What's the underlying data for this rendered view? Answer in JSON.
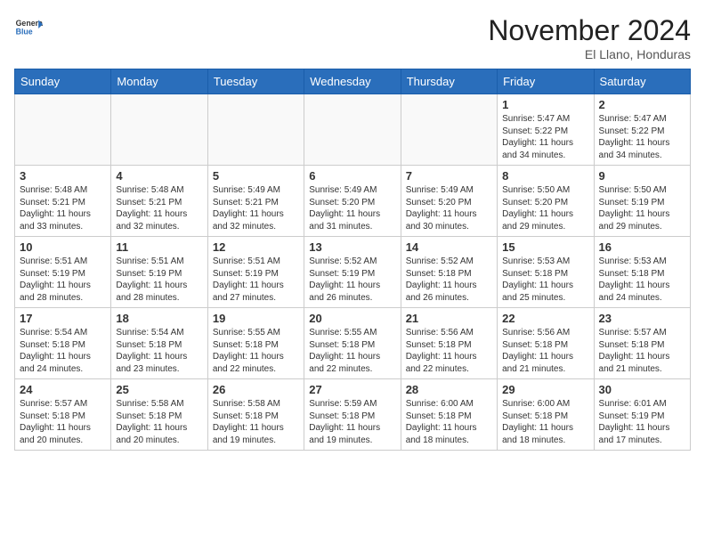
{
  "header": {
    "logo_general": "General",
    "logo_blue": "Blue",
    "month_year": "November 2024",
    "location": "El Llano, Honduras"
  },
  "days_of_week": [
    "Sunday",
    "Monday",
    "Tuesday",
    "Wednesday",
    "Thursday",
    "Friday",
    "Saturday"
  ],
  "weeks": [
    [
      {
        "day": "",
        "empty": true
      },
      {
        "day": "",
        "empty": true
      },
      {
        "day": "",
        "empty": true
      },
      {
        "day": "",
        "empty": true
      },
      {
        "day": "",
        "empty": true
      },
      {
        "day": "1",
        "sunrise": "5:47 AM",
        "sunset": "5:22 PM",
        "daylight": "11 hours and 34 minutes."
      },
      {
        "day": "2",
        "sunrise": "5:47 AM",
        "sunset": "5:22 PM",
        "daylight": "11 hours and 34 minutes."
      }
    ],
    [
      {
        "day": "3",
        "sunrise": "5:48 AM",
        "sunset": "5:21 PM",
        "daylight": "11 hours and 33 minutes."
      },
      {
        "day": "4",
        "sunrise": "5:48 AM",
        "sunset": "5:21 PM",
        "daylight": "11 hours and 32 minutes."
      },
      {
        "day": "5",
        "sunrise": "5:49 AM",
        "sunset": "5:21 PM",
        "daylight": "11 hours and 32 minutes."
      },
      {
        "day": "6",
        "sunrise": "5:49 AM",
        "sunset": "5:20 PM",
        "daylight": "11 hours and 31 minutes."
      },
      {
        "day": "7",
        "sunrise": "5:49 AM",
        "sunset": "5:20 PM",
        "daylight": "11 hours and 30 minutes."
      },
      {
        "day": "8",
        "sunrise": "5:50 AM",
        "sunset": "5:20 PM",
        "daylight": "11 hours and 29 minutes."
      },
      {
        "day": "9",
        "sunrise": "5:50 AM",
        "sunset": "5:19 PM",
        "daylight": "11 hours and 29 minutes."
      }
    ],
    [
      {
        "day": "10",
        "sunrise": "5:51 AM",
        "sunset": "5:19 PM",
        "daylight": "11 hours and 28 minutes."
      },
      {
        "day": "11",
        "sunrise": "5:51 AM",
        "sunset": "5:19 PM",
        "daylight": "11 hours and 28 minutes."
      },
      {
        "day": "12",
        "sunrise": "5:51 AM",
        "sunset": "5:19 PM",
        "daylight": "11 hours and 27 minutes."
      },
      {
        "day": "13",
        "sunrise": "5:52 AM",
        "sunset": "5:19 PM",
        "daylight": "11 hours and 26 minutes."
      },
      {
        "day": "14",
        "sunrise": "5:52 AM",
        "sunset": "5:18 PM",
        "daylight": "11 hours and 26 minutes."
      },
      {
        "day": "15",
        "sunrise": "5:53 AM",
        "sunset": "5:18 PM",
        "daylight": "11 hours and 25 minutes."
      },
      {
        "day": "16",
        "sunrise": "5:53 AM",
        "sunset": "5:18 PM",
        "daylight": "11 hours and 24 minutes."
      }
    ],
    [
      {
        "day": "17",
        "sunrise": "5:54 AM",
        "sunset": "5:18 PM",
        "daylight": "11 hours and 24 minutes."
      },
      {
        "day": "18",
        "sunrise": "5:54 AM",
        "sunset": "5:18 PM",
        "daylight": "11 hours and 23 minutes."
      },
      {
        "day": "19",
        "sunrise": "5:55 AM",
        "sunset": "5:18 PM",
        "daylight": "11 hours and 22 minutes."
      },
      {
        "day": "20",
        "sunrise": "5:55 AM",
        "sunset": "5:18 PM",
        "daylight": "11 hours and 22 minutes."
      },
      {
        "day": "21",
        "sunrise": "5:56 AM",
        "sunset": "5:18 PM",
        "daylight": "11 hours and 22 minutes."
      },
      {
        "day": "22",
        "sunrise": "5:56 AM",
        "sunset": "5:18 PM",
        "daylight": "11 hours and 21 minutes."
      },
      {
        "day": "23",
        "sunrise": "5:57 AM",
        "sunset": "5:18 PM",
        "daylight": "11 hours and 21 minutes."
      }
    ],
    [
      {
        "day": "24",
        "sunrise": "5:57 AM",
        "sunset": "5:18 PM",
        "daylight": "11 hours and 20 minutes."
      },
      {
        "day": "25",
        "sunrise": "5:58 AM",
        "sunset": "5:18 PM",
        "daylight": "11 hours and 20 minutes."
      },
      {
        "day": "26",
        "sunrise": "5:58 AM",
        "sunset": "5:18 PM",
        "daylight": "11 hours and 19 minutes."
      },
      {
        "day": "27",
        "sunrise": "5:59 AM",
        "sunset": "5:18 PM",
        "daylight": "11 hours and 19 minutes."
      },
      {
        "day": "28",
        "sunrise": "6:00 AM",
        "sunset": "5:18 PM",
        "daylight": "11 hours and 18 minutes."
      },
      {
        "day": "29",
        "sunrise": "6:00 AM",
        "sunset": "5:18 PM",
        "daylight": "11 hours and 18 minutes."
      },
      {
        "day": "30",
        "sunrise": "6:01 AM",
        "sunset": "5:19 PM",
        "daylight": "11 hours and 17 minutes."
      }
    ]
  ]
}
